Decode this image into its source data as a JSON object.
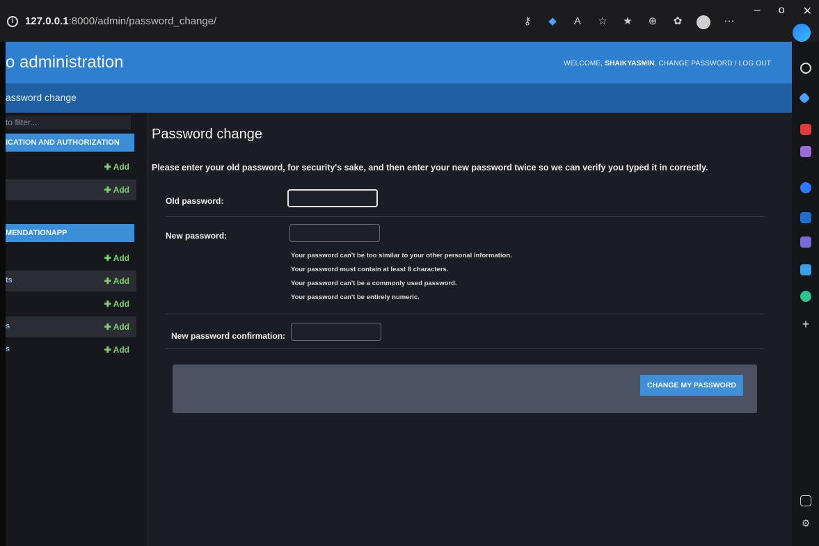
{
  "browser": {
    "url_host": "127.0.0.1",
    "url_rest": ":8000/admin/password_change/"
  },
  "header": {
    "site_name": "o administration",
    "welcome": "WELCOME,",
    "username": "SHAIKYASMIN",
    "change_password": "CHANGE PASSWORD",
    "separator": "/",
    "logout": "LOG OUT"
  },
  "breadcrumbs": {
    "current": "assword change"
  },
  "sidebar": {
    "filter_placeholder": "to filter...",
    "modules": [
      {
        "title": "ICATION AND AUTHORIZATION",
        "rows": [
          {
            "label": "",
            "add": "Add"
          },
          {
            "label": "",
            "add": "Add"
          }
        ]
      },
      {
        "title": "MENDATIONAPP",
        "rows": [
          {
            "label": "",
            "add": "Add"
          },
          {
            "label": "ts",
            "add": "Add"
          },
          {
            "label": "",
            "add": "Add"
          },
          {
            "label": "s",
            "add": "Add"
          },
          {
            "label": "s",
            "add": "Add"
          }
        ]
      }
    ]
  },
  "form": {
    "title": "Password change",
    "intro": "Please enter your old password, for security's sake, and then enter your new password twice so we can verify you typed it in correctly.",
    "old_password_label": "Old password:",
    "new_password_label": "New password:",
    "help": [
      "Your password can't be too similar to your other personal information.",
      "Your password must contain at least 8 characters.",
      "Your password can't be a commonly used password.",
      "Your password can't be entirely numeric."
    ],
    "confirm_label": "New password confirmation:",
    "submit_label": "CHANGE MY PASSWORD"
  },
  "colors": {
    "header_bg": "#2f7fd0",
    "breadcrumbs_bg": "#1f5fa3",
    "module_bg": "#3b8ed8",
    "add_link": "#7fd06c",
    "submit_bg": "#3f8fd6"
  }
}
